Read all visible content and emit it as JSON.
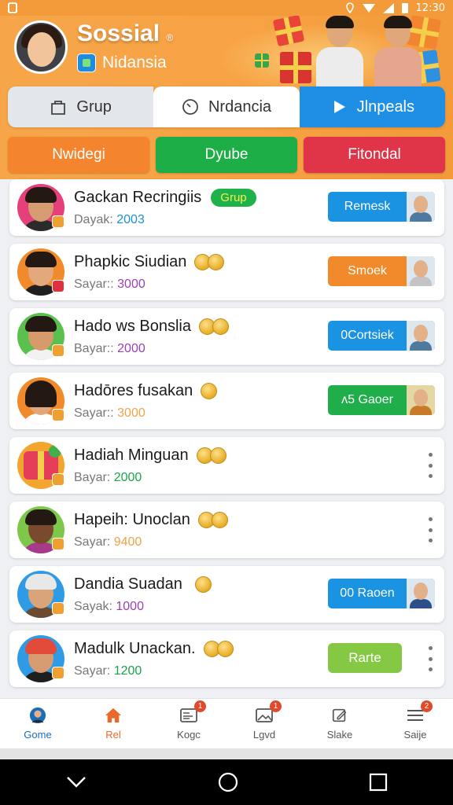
{
  "status_bar": {
    "time": "12:30"
  },
  "header": {
    "title": "Sossial",
    "title_mark": "®",
    "subtitle": "Nidansia"
  },
  "tabs": [
    {
      "label": "Grup",
      "icon": "bag-icon"
    },
    {
      "label": "Nrdancia",
      "icon": "clock-icon"
    },
    {
      "label": "Jlnpeals",
      "icon": "play-icon"
    }
  ],
  "categories": [
    {
      "label": "Nwidegi",
      "color": "#f4852e"
    },
    {
      "label": "Dyube",
      "color": "#1eae48"
    },
    {
      "label": "Fitondal",
      "color": "#e03448"
    }
  ],
  "rows": [
    {
      "name": "Gackan Recringiis",
      "tag": "Grup",
      "label": "Dayak:",
      "value": "2003",
      "value_color": "#1c8fd6",
      "action": "Remesk",
      "action_color": "#1a93e3"
    },
    {
      "name": "Phapkic Siudian",
      "label": "Sayar::",
      "value": "3000",
      "value_color": "#9b3fb5",
      "action": "Smoek",
      "action_color": "#f28a2b"
    },
    {
      "name": "Hado ws Bonslia",
      "label": "Bayar::",
      "value": "2000",
      "value_color": "#9b3fb5",
      "action": "0Cortsiek",
      "action_color": "#1a93e3"
    },
    {
      "name": "Hadōres fusakan",
      "label": "Sayar::",
      "value": "3000",
      "value_color": "#f0a24a",
      "action": "ʌ5 Gaoer",
      "action_color": "#1fae4a"
    },
    {
      "name": "Hadiah Minguan",
      "label": "Bayar:",
      "value": "2000",
      "value_color": "#1aa34a"
    },
    {
      "name": "Hapeih: Unoclan",
      "label": "Sayar:",
      "value": "9400",
      "value_color": "#f0a24a"
    },
    {
      "name": "Dandia Suadan",
      "label": "Sayak:",
      "value": "1000",
      "value_color": "#9b3fb5",
      "action": "00 Raoen",
      "action_color": "#1a93e3"
    },
    {
      "name": "Madulk Unackan.",
      "label": "Sayar:",
      "value": "1200",
      "value_color": "#1aa34a",
      "action": "Rarte",
      "action_color": "#84c843"
    }
  ],
  "bottom_nav": [
    {
      "label": "Gome",
      "icon": "profile-icon"
    },
    {
      "label": "Rel",
      "icon": "home-icon"
    },
    {
      "label": "Kogc",
      "icon": "news-icon",
      "badge": "1"
    },
    {
      "label": "Lgvd",
      "icon": "gallery-icon",
      "badge": "1"
    },
    {
      "label": "Slake",
      "icon": "edit-icon"
    },
    {
      "label": "Saije",
      "icon": "menu-icon",
      "badge": "2"
    }
  ]
}
